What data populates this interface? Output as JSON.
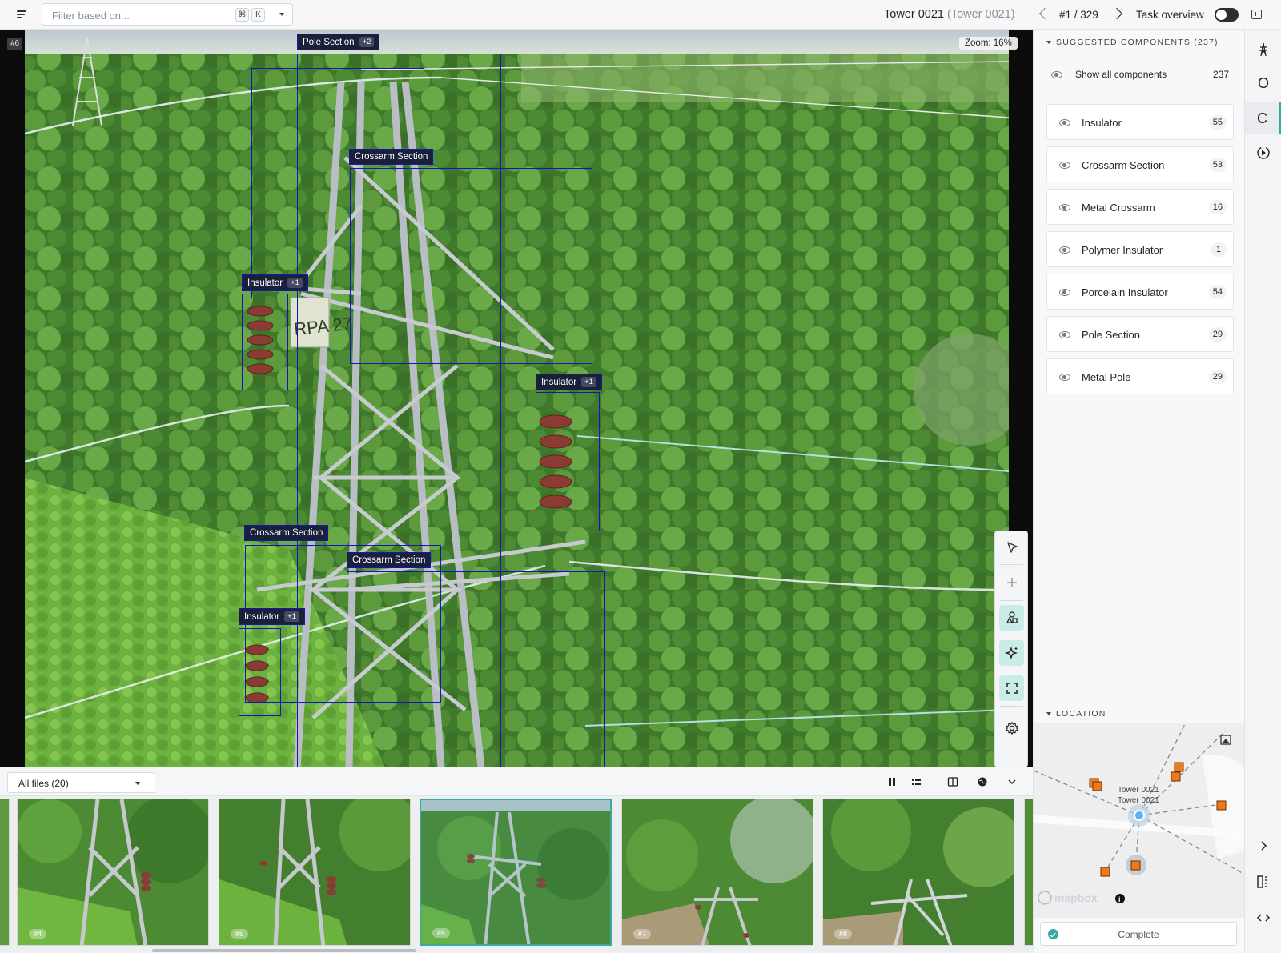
{
  "topbar": {
    "filter_placeholder": "Filter based on...",
    "shortcut_cmd": "⌘",
    "shortcut_key": "K",
    "title": "Tower 0021",
    "title_sub": "(Tower 0021)",
    "counter": "#1 / 329",
    "task_overview_label": "Task overview",
    "task_overview_on": false
  },
  "viewer": {
    "image_id": "#6",
    "zoom_label": "Zoom: 16%",
    "annotations": [
      {
        "label": "Pole Section",
        "more": "+2"
      },
      {
        "label": "Crossarm Section",
        "more": ""
      },
      {
        "label": "Insulator",
        "more": "+1"
      },
      {
        "label": "Insulator",
        "more": "+1"
      },
      {
        "label": "Crossarm Section",
        "more": ""
      },
      {
        "label": "Crossarm Section",
        "more": ""
      },
      {
        "label": "Insulator",
        "more": "+1"
      }
    ],
    "tools": [
      "select-pointer-icon",
      "add-icon",
      "shapes-icon",
      "ai-sparkle-icon",
      "fit-screen-icon",
      "settings-icon"
    ]
  },
  "filebar": {
    "files_label": "All files (20)",
    "thumbnails": [
      {
        "label": "#4"
      },
      {
        "label": "#5"
      },
      {
        "label": "#6",
        "active": true
      },
      {
        "label": "#7"
      },
      {
        "label": "#8"
      }
    ]
  },
  "components": {
    "header": "SUGGESTED COMPONENTS (237)",
    "show_all_label": "Show all components",
    "show_all_count": "237",
    "items": [
      {
        "label": "Insulator",
        "count": "55"
      },
      {
        "label": "Crossarm Section",
        "count": "53"
      },
      {
        "label": "Metal Crossarm",
        "count": "16"
      },
      {
        "label": "Polymer Insulator",
        "count": "1"
      },
      {
        "label": "Porcelain Insulator",
        "count": "54"
      },
      {
        "label": "Pole Section",
        "count": "29"
      },
      {
        "label": "Metal Pole",
        "count": "29"
      }
    ]
  },
  "location": {
    "header": "LOCATION",
    "map_label_1": "Tower 0021",
    "map_label_2": "Tower 0021",
    "map_brand": "mapbox",
    "complete_label": "Complete"
  },
  "rail": {
    "items": [
      "tower-icon",
      "O",
      "C",
      "play-history-icon"
    ]
  },
  "colors": {
    "bbox": "#1515b8",
    "accent": "#3aa9a4",
    "marker": "#ef7a1a"
  }
}
